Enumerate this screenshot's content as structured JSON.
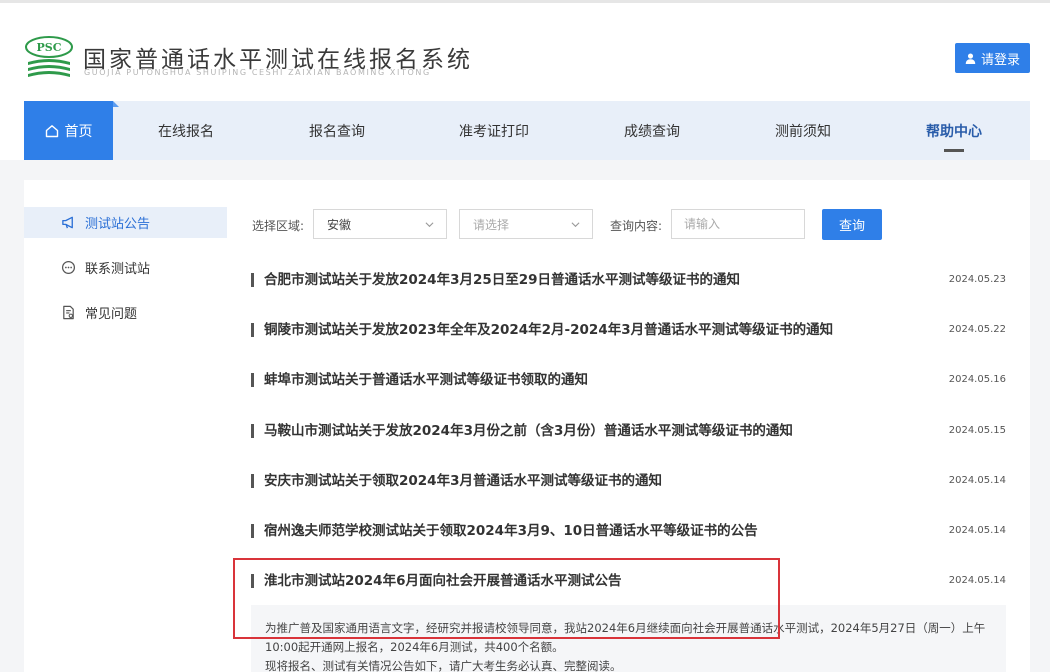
{
  "header": {
    "logo_text": "PSC",
    "title": "国家普通话水平测试在线报名系统",
    "subtitle": "GUOJIA PUTONGHUA SHUIPING CESHI ZAIXIAN BAOMING XITONG",
    "login_label": "请登录"
  },
  "nav": {
    "items": [
      {
        "label": "首页"
      },
      {
        "label": "在线报名"
      },
      {
        "label": "报名查询"
      },
      {
        "label": "准考证打印"
      },
      {
        "label": "成绩查询"
      },
      {
        "label": "测前须知"
      },
      {
        "label": "帮助中心"
      }
    ]
  },
  "sidebar": {
    "items": [
      {
        "label": "测试站公告"
      },
      {
        "label": "联系测试站"
      },
      {
        "label": "常见问题"
      }
    ]
  },
  "filter": {
    "region_label": "选择区域:",
    "province_value": "安徽",
    "city_placeholder": "请选择",
    "query_label": "查询内容:",
    "query_placeholder": "请输入",
    "query_button": "查询"
  },
  "notices": [
    {
      "title": "合肥市测试站关于发放2024年3月25日至29日普通话水平测试等级证书的通知",
      "date": "2024.05.23"
    },
    {
      "title": "铜陵市测试站关于发放2023年全年及2024年2月-2024年3月普通话水平测试等级证书的通知",
      "date": "2024.05.22"
    },
    {
      "title": "蚌埠市测试站关于普通话水平测试等级证书领取的通知",
      "date": "2024.05.16"
    },
    {
      "title": "马鞍山市测试站关于发放2024年3月份之前（含3月份）普通话水平测试等级证书的通知",
      "date": "2024.05.15"
    },
    {
      "title": "安庆市测试站关于领取2024年3月普通话水平测试等级证书的通知",
      "date": "2024.05.14"
    },
    {
      "title": "宿州逸夫师范学校测试站关于领取2024年3月9、10日普通话水平等级证书的公告",
      "date": "2024.05.14"
    },
    {
      "title": "淮北市测试站2024年6月面向社会开展普通话水平测试公告",
      "date": "2024.05.14"
    }
  ],
  "excerpt": {
    "line1": "为推广普及国家通用语言文字，经研究并报请校领导同意，我站2024年6月继续面向社会开展普通话水平测试，2024年5月27日（周一）上午",
    "line2": "10:00起开通网上报名，2024年6月测试，共400个名额。",
    "line3": "现将报名、测试有关情况公告如下，请广大考生务必认真、完整阅读。"
  },
  "colors": {
    "accent": "#2f7fe8",
    "nav_bg": "#e8eff9",
    "highlight": "#d9343a",
    "logo_green": "#2e9a4a"
  }
}
